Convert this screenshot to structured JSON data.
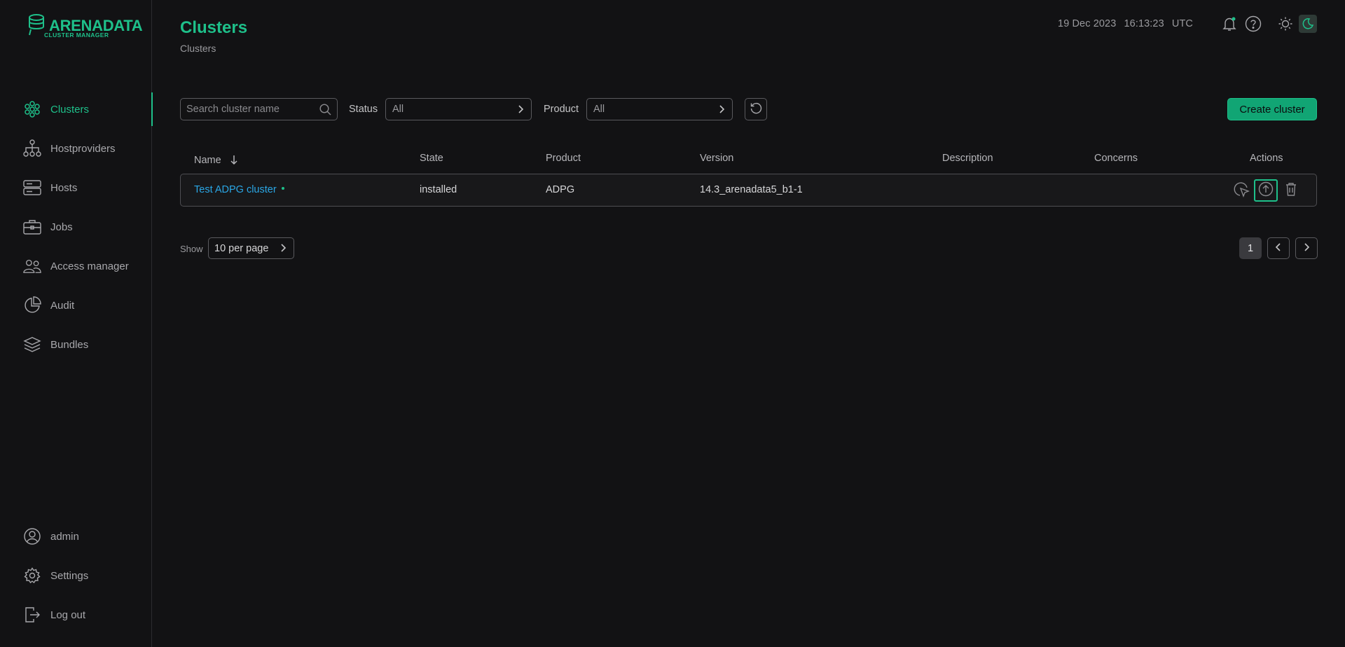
{
  "app": {
    "brand": "ARENADATA",
    "brand_sub": "CLUSTER MANAGER"
  },
  "sidebar": {
    "items": [
      {
        "label": "Clusters",
        "icon": "clusters-icon",
        "active": true
      },
      {
        "label": "Hostproviders",
        "icon": "hostproviders-icon"
      },
      {
        "label": "Hosts",
        "icon": "hosts-icon"
      },
      {
        "label": "Jobs",
        "icon": "jobs-icon"
      },
      {
        "label": "Access manager",
        "icon": "access-manager-icon"
      },
      {
        "label": "Audit",
        "icon": "audit-icon"
      },
      {
        "label": "Bundles",
        "icon": "bundles-icon"
      }
    ],
    "bottom": [
      {
        "label": "admin",
        "icon": "user-icon"
      },
      {
        "label": "Settings",
        "icon": "gear-icon"
      },
      {
        "label": "Log out",
        "icon": "logout-icon"
      }
    ]
  },
  "header": {
    "title": "Clusters",
    "breadcrumb": "Clusters",
    "date": "19 Dec 2023",
    "time": "16:13:23",
    "tz": "UTC"
  },
  "filters": {
    "search_placeholder": "Search cluster name",
    "status_label": "Status",
    "status_value": "All",
    "product_label": "Product",
    "product_value": "All",
    "create_label": "Create cluster"
  },
  "table": {
    "columns": [
      "Name",
      "State",
      "Product",
      "Version",
      "Description",
      "Concerns",
      "Actions"
    ],
    "rows": [
      {
        "name": "Test ADPG cluster",
        "state": "installed",
        "product": "ADPG",
        "version": "14.3_arenadata5_b1-1",
        "description": "",
        "concerns": ""
      }
    ]
  },
  "pagination": {
    "show_label": "Show",
    "per_page": "10 per page",
    "current_page": "1"
  },
  "colors": {
    "accent": "#1ec08a",
    "link": "#2aa7e6",
    "background": "#121214"
  }
}
